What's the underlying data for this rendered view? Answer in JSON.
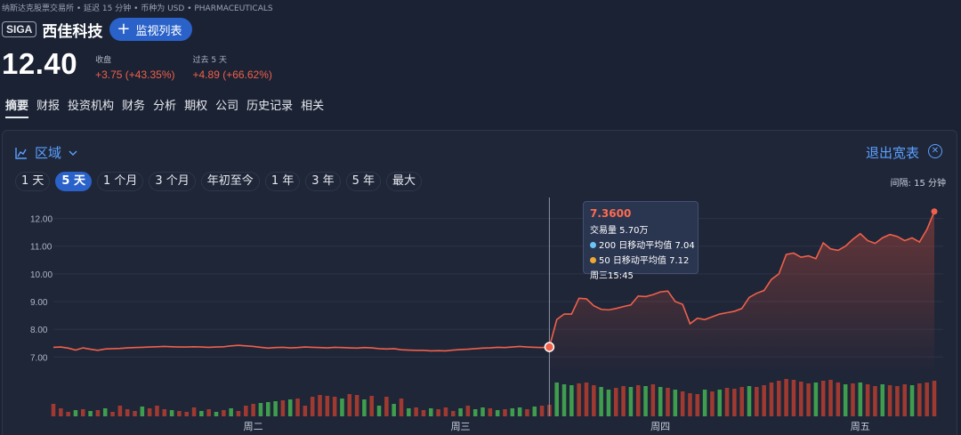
{
  "breadcrumb": "纳斯达克股票交易所 • 延迟 15 分钟 • 币种为 USD • PHARMACEUTICALS",
  "ticker": "SIGA",
  "company": "西佳科技",
  "watch_button": "监视列表",
  "price": "12.40",
  "close_label": "收盘",
  "close_change": "+3.75 (+43.35%)",
  "period_label": "过去 5 天",
  "period_change": "+4.89 (+66.62%)",
  "tabs": [
    "摘要",
    "财报",
    "投资机构",
    "财务",
    "分析",
    "期权",
    "公司",
    "历史记录",
    "相关"
  ],
  "active_tab": 0,
  "chart_panel": {
    "mode_label": "区域",
    "exit_label": "退出宽表",
    "ranges": [
      "1 天",
      "5 天",
      "1 个月",
      "3 个月",
      "年初至今",
      "1 年",
      "3 年",
      "5 年",
      "最大"
    ],
    "active_range": 1,
    "interval": "间隔: 15 分钟"
  },
  "tooltip": {
    "price": "7.3600",
    "volume": "交易量 5.70万",
    "ma200": "200 日移动平均值 7.04",
    "ma50": "50 日移动平均值 7.12",
    "time": "周三15:45"
  },
  "colors": {
    "up_line": "#f0604a",
    "ma200": "#6cc4f5",
    "ma50": "#f0a830",
    "vol_up": "#3f9e4e",
    "vol_down": "#a03a30",
    "accent": "#2a62c9"
  },
  "chart_data": {
    "type": "line",
    "ylim": [
      6.4,
      12.5
    ],
    "yticks": [
      "12.00",
      "11.00",
      "10.00",
      "9.00",
      "8.00",
      "7.00"
    ],
    "ytick_values": [
      12,
      11,
      10,
      9,
      8,
      7
    ],
    "xticks": [
      "周二",
      "周三",
      "周四",
      "周五"
    ],
    "xtick_bar_index": [
      27,
      55,
      82,
      109
    ],
    "price_series": [
      7.35,
      7.36,
      7.32,
      7.25,
      7.33,
      7.28,
      7.24,
      7.29,
      7.3,
      7.31,
      7.33,
      7.34,
      7.35,
      7.36,
      7.37,
      7.38,
      7.37,
      7.36,
      7.36,
      7.37,
      7.36,
      7.35,
      7.36,
      7.37,
      7.4,
      7.42,
      7.4,
      7.38,
      7.35,
      7.32,
      7.34,
      7.35,
      7.33,
      7.34,
      7.36,
      7.35,
      7.34,
      7.33,
      7.35,
      7.34,
      7.33,
      7.32,
      7.34,
      7.33,
      7.3,
      7.29,
      7.3,
      7.26,
      7.25,
      7.24,
      7.24,
      7.22,
      7.23,
      7.22,
      7.25,
      7.27,
      7.28,
      7.3,
      7.32,
      7.33,
      7.35,
      7.34,
      7.36,
      7.38,
      7.36,
      7.35,
      7.34,
      7.36,
      8.35,
      8.55,
      8.55,
      9.12,
      9.1,
      8.85,
      8.72,
      8.7,
      8.75,
      8.82,
      8.88,
      9.2,
      9.18,
      9.25,
      9.35,
      9.38,
      9.0,
      8.9,
      8.2,
      8.4,
      8.35,
      8.45,
      8.55,
      8.6,
      8.65,
      8.75,
      9.15,
      9.3,
      9.4,
      9.8,
      10.0,
      10.7,
      10.75,
      10.6,
      10.65,
      10.55,
      11.12,
      10.9,
      10.85,
      11.0,
      11.25,
      11.45,
      11.2,
      11.1,
      11.3,
      11.42,
      11.35,
      11.2,
      11.3,
      11.15,
      11.6,
      12.25
    ],
    "volume_series": [
      14,
      9,
      5,
      7,
      8,
      6,
      7,
      9,
      5,
      12,
      8,
      6,
      11,
      9,
      12,
      8,
      7,
      6,
      5,
      10,
      6,
      8,
      5,
      7,
      9,
      6,
      12,
      14,
      15,
      16,
      17,
      18,
      19,
      20,
      12,
      22,
      24,
      23,
      22,
      20,
      25,
      24,
      19,
      23,
      12,
      22,
      14,
      20,
      9,
      10,
      7,
      9,
      8,
      10,
      6,
      9,
      12,
      8,
      10,
      9,
      7,
      8,
      9,
      10,
      8,
      11,
      12,
      13,
      38,
      36,
      35,
      37,
      38,
      35,
      33,
      30,
      32,
      34,
      33,
      35,
      34,
      36,
      33,
      32,
      30,
      28,
      26,
      25,
      30,
      28,
      30,
      32,
      31,
      33,
      34,
      33,
      35,
      38,
      40,
      42,
      41,
      39,
      37,
      38,
      40,
      41,
      38,
      36,
      37,
      38,
      36,
      34,
      36,
      35,
      34,
      36,
      35,
      37,
      38,
      40
    ],
    "volume_up": [
      0,
      0,
      0,
      1,
      0,
      1,
      0,
      1,
      0,
      0,
      0,
      0,
      1,
      0,
      0,
      0,
      1,
      0,
      0,
      0,
      1,
      0,
      1,
      0,
      1,
      0,
      0,
      0,
      1,
      1,
      1,
      0,
      1,
      0,
      0,
      0,
      0,
      0,
      0,
      1,
      0,
      0,
      1,
      0,
      1,
      0,
      1,
      0,
      1,
      0,
      0,
      1,
      0,
      0,
      0,
      1,
      0,
      1,
      1,
      0,
      1,
      0,
      1,
      1,
      0,
      1,
      0,
      0,
      1,
      1,
      1,
      0,
      0,
      0,
      1,
      1,
      0,
      0,
      1,
      0,
      1,
      0,
      1,
      0,
      1,
      0,
      0,
      0,
      1,
      0,
      1,
      0,
      0,
      0,
      1,
      0,
      0,
      0,
      0,
      0,
      0,
      0,
      0,
      1,
      0,
      0,
      0,
      1,
      0,
      1,
      0,
      0,
      1,
      0,
      0,
      0,
      1,
      0,
      0,
      0
    ],
    "hover_index": 67
  }
}
